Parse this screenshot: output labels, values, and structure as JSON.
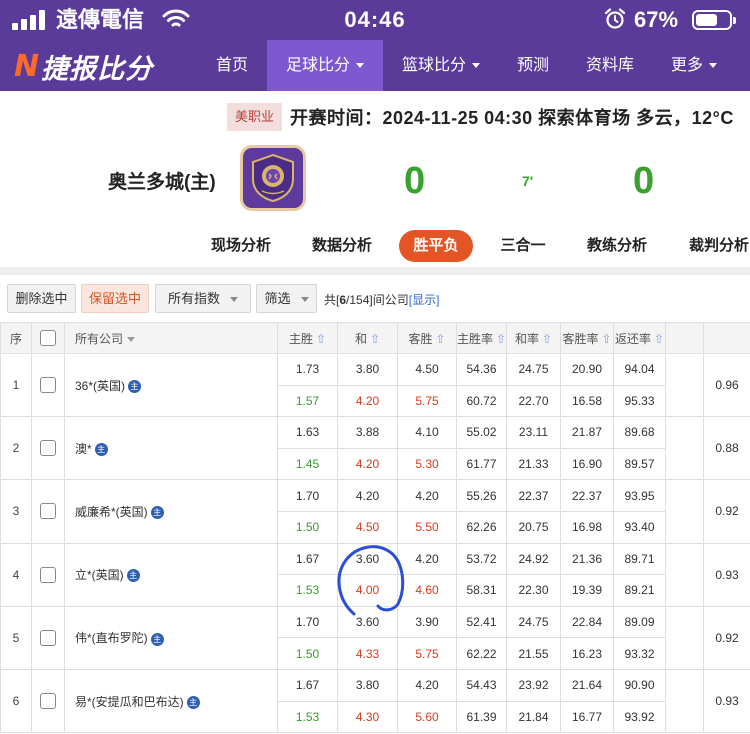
{
  "status_bar": {
    "carrier": "遠傳電信",
    "time": "04:46",
    "battery_pct": "67%",
    "battery_level": 0.67
  },
  "nav": {
    "logo_mark": "N",
    "logo_text": "捷报比分",
    "items": [
      {
        "label": "首页",
        "has_caret": false
      },
      {
        "label": "足球比分",
        "has_caret": true
      },
      {
        "label": "篮球比分",
        "has_caret": true
      },
      {
        "label": "预测",
        "has_caret": false
      },
      {
        "label": "资料库",
        "has_caret": false
      },
      {
        "label": "更多",
        "has_caret": true
      }
    ],
    "active_index": 1
  },
  "match": {
    "league": "美职业",
    "kickoff": "开赛时间：2024-11-25 04:30   探索体育场   多云，12°C",
    "home_team": "奥兰多城(主)",
    "home_score": "0",
    "away_score": "0",
    "minute": "7'"
  },
  "tabs": [
    {
      "label": "现场分析"
    },
    {
      "label": "数据分析"
    },
    {
      "label": "胜平负"
    },
    {
      "label": "三合一"
    },
    {
      "label": "教练分析"
    },
    {
      "label": "裁判分析"
    }
  ],
  "toolbar": {
    "delete_selected": "删除选中",
    "keep_selected": "保留选中",
    "all_index": "所有指数",
    "filter": "筛选",
    "summary_prefix": "共[",
    "summary_shown": "6",
    "summary_mid": "/154]间公司",
    "show_link": "[显示]"
  },
  "table": {
    "headers": {
      "idx": "序",
      "company": "所有公司",
      "home": "主胜",
      "draw": "和",
      "away": "客胜",
      "home_rate": "主胜率",
      "draw_rate": "和率",
      "away_rate": "客胜率",
      "return_rate": "返还率"
    },
    "badge": "主",
    "rows": [
      {
        "idx": "1",
        "company": "36*(英国)",
        "open": [
          "1.73",
          "3.80",
          "4.50"
        ],
        "live": [
          "1.57",
          "4.20",
          "5.75"
        ],
        "open_rates": [
          "54.36",
          "24.75",
          "20.90",
          "94.04"
        ],
        "live_rates": [
          "60.72",
          "22.70",
          "16.58",
          "95.33"
        ],
        "kelly": "0.96"
      },
      {
        "idx": "2",
        "company": "澳*",
        "open": [
          "1.63",
          "3.88",
          "4.10"
        ],
        "live": [
          "1.45",
          "4.20",
          "5.30"
        ],
        "open_rates": [
          "55.02",
          "23.11",
          "21.87",
          "89.68"
        ],
        "live_rates": [
          "61.77",
          "21.33",
          "16.90",
          "89.57"
        ],
        "kelly": "0.88"
      },
      {
        "idx": "3",
        "company": "威廉希*(英国)",
        "open": [
          "1.70",
          "4.20",
          "4.20"
        ],
        "live": [
          "1.50",
          "4.50",
          "5.50"
        ],
        "open_rates": [
          "55.26",
          "22.37",
          "22.37",
          "93.95"
        ],
        "live_rates": [
          "62.26",
          "20.75",
          "16.98",
          "93.40"
        ],
        "kelly": "0.92"
      },
      {
        "idx": "4",
        "company": "立*(英国)",
        "open": [
          "1.67",
          "3.60",
          "4.20"
        ],
        "live": [
          "1.53",
          "4.00",
          "4.60"
        ],
        "open_rates": [
          "53.72",
          "24.92",
          "21.36",
          "89.71"
        ],
        "live_rates": [
          "58.31",
          "22.30",
          "19.39",
          "89.21"
        ],
        "kelly": "0.93"
      },
      {
        "idx": "5",
        "company": "伟*(直布罗陀)",
        "open": [
          "1.70",
          "3.60",
          "3.90"
        ],
        "live": [
          "1.50",
          "4.33",
          "5.75"
        ],
        "open_rates": [
          "52.41",
          "24.75",
          "22.84",
          "89.09"
        ],
        "live_rates": [
          "62.22",
          "21.55",
          "16.23",
          "93.32"
        ],
        "kelly": "0.92"
      },
      {
        "idx": "6",
        "company": "易*(安提瓜和巴布达)",
        "open": [
          "1.67",
          "3.80",
          "4.20"
        ],
        "live": [
          "1.53",
          "4.30",
          "5.60"
        ],
        "open_rates": [
          "54.43",
          "23.92",
          "21.64",
          "90.90"
        ],
        "live_rates": [
          "61.39",
          "21.84",
          "16.77",
          "93.92"
        ],
        "kelly": "0.93"
      }
    ]
  },
  "colors": {
    "brand_purple": "#5b3b9a",
    "nav_active": "#7e58d0",
    "accent_orange": "#e35525",
    "odds_green": "#3a9a2e",
    "odds_red": "#d73c1e",
    "ink_blue": "#2a4fd6"
  }
}
